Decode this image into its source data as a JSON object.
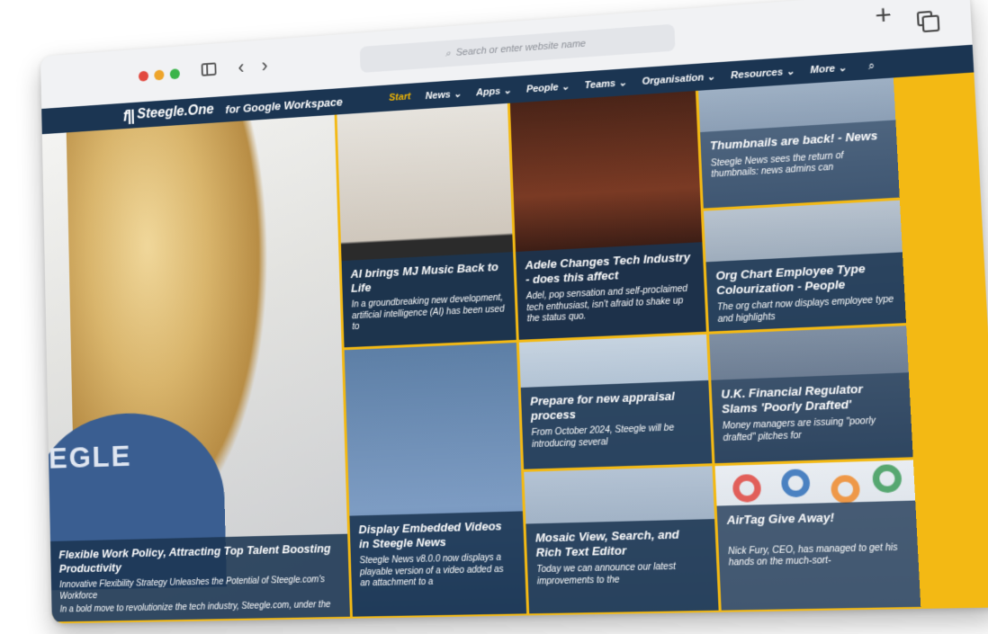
{
  "browser": {
    "address_placeholder": "Search or enter website name",
    "colors": {
      "close": "#e2493f",
      "minimize": "#eea52b",
      "maximize": "#3bb44a"
    },
    "icons": [
      "sidebar-icon",
      "chevron-left-icon",
      "chevron-right-icon",
      "search-icon",
      "plus-icon",
      "tabs-icon"
    ]
  },
  "site": {
    "logo": "Steegle.One",
    "logo_sub": "for Google Workspace",
    "brand_color": "#1b3552",
    "accent_color": "#f3b914",
    "nav": [
      {
        "label": "Start"
      },
      {
        "label": "News ⌄"
      },
      {
        "label": "Apps ⌄"
      },
      {
        "label": "People ⌄"
      },
      {
        "label": "Teams ⌄"
      },
      {
        "label": "Organisation ⌄"
      },
      {
        "label": "Resources ⌄"
      },
      {
        "label": "More ⌄"
      }
    ]
  },
  "tiles": {
    "hero": {
      "title": "Flexible Work Policy, Attracting Top Talent Boosting Productivity",
      "subtitle": "Innovative Flexibility Strategy Unleashes the Potential of Steegle.com's Workforce",
      "excerpt": "In a bold move to revolutionize the tech industry, Steegle.com, under the",
      "shirt_text": "EGLE"
    },
    "mj": {
      "title": "AI brings MJ Music Back to Life",
      "excerpt": "In a groundbreaking new development, artificial intelligence (AI) has been used to"
    },
    "adele": {
      "title": "Adele Changes Tech Industry - does this affect",
      "excerpt": "Adel, pop sensation and self-proclaimed tech enthusiast, isn't afraid to shake up the status quo."
    },
    "thumbnails": {
      "title": "Thumbnails are back! - News",
      "excerpt": "Steegle News sees the return of thumbnails: news admins can"
    },
    "org": {
      "title": "Org Chart Employee Type Colourization - People",
      "excerpt": "The org chart now displays employee type and highlights"
    },
    "embed": {
      "title": "Display Embedded Videos in Steegle News",
      "excerpt": "Steegle News v8.0.0 now displays a playable version of a video added as an attachment to a"
    },
    "appraisal": {
      "title": "Prepare for new appraisal process",
      "excerpt": "From October 2024, Steegle will be introducing several"
    },
    "uk": {
      "title": "U.K. Financial Regulator Slams 'Poorly Drafted'",
      "excerpt": "Money managers are issuing \"poorly drafted\" pitches for"
    },
    "mosaic": {
      "title": "Mosaic View, Search, and Rich Text Editor",
      "excerpt": "Today we can announce our latest improvements to the"
    },
    "airtag": {
      "title": "AirTag Give Away!",
      "excerpt": "Nick Fury, CEO, has managed to get his hands on the much-sort-"
    }
  }
}
